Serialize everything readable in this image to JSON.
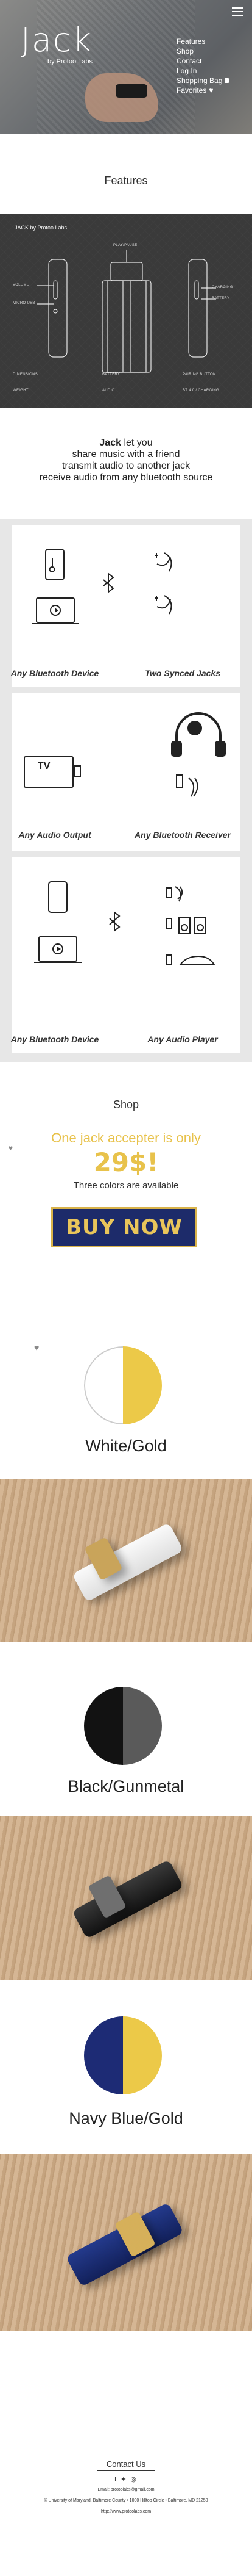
{
  "header": {
    "logo": "Jack",
    "logo_sub": "by Protoo Labs",
    "nav": [
      {
        "label": "Features"
      },
      {
        "label": "Shop"
      },
      {
        "label": "Contact"
      },
      {
        "label": "Log In"
      },
      {
        "label": "Shopping Bag"
      },
      {
        "label": "Favorites"
      }
    ]
  },
  "features": {
    "heading": "Features",
    "spec_title": "JACK by Protoo Labs",
    "labels": [
      {
        "text": "VOLUME"
      },
      {
        "text": "PAIRING BUTTON"
      },
      {
        "text": "PLAY/PAUSE"
      },
      {
        "text": "MICRO USB"
      },
      {
        "text": "BATTERY"
      },
      {
        "text": "WEIGHT"
      },
      {
        "text": "AUDIO"
      },
      {
        "text": "BT 4.0 / CHARGING"
      },
      {
        "text": "DIMENSIONS"
      }
    ],
    "labels_right": [
      {
        "text": "CHARGING"
      },
      {
        "text": "BATTERY"
      },
      {
        "text": "BT / 4.0"
      }
    ],
    "intro_lines": [
      {
        "text": "let you",
        "bold": "Jack"
      },
      {
        "text": "share music with a friend"
      },
      {
        "text": "transmit audio to another jack"
      },
      {
        "text": "receive audio from any bluetooth source"
      }
    ]
  },
  "usage": {
    "captions": [
      {
        "text": "Any Bluetooth Device"
      },
      {
        "text": "Two Synced Jacks"
      },
      {
        "text": "Any Audio Output"
      },
      {
        "text": "Any Bluetooth Receiver"
      },
      {
        "text": "Any Bluetooth Device"
      },
      {
        "text": "Any Audio Player"
      }
    ],
    "tv_label": "TV"
  },
  "shop": {
    "heading": "Shop",
    "offer_prefix": "One jack accepter is only",
    "price": "29$!",
    "colors_note": "Three colors are available",
    "buy_label": "BUY NOW",
    "colors": [
      {
        "name": "White/Gold",
        "left": "#ffffff",
        "right": "#ecc948"
      },
      {
        "name": "Black/Gunmetal",
        "left": "#121212",
        "right": "#5a5a5a"
      },
      {
        "name": "Navy Blue/Gold",
        "left": "#1d2b75",
        "right": "#ecc948"
      }
    ]
  },
  "footer": {
    "heading": "Contact Us",
    "email": "Email: protoolabs@gmail.com",
    "address": "© University of Maryland, Baltimore County • 1000 Hilltop Circle • Baltimore, MD 21250",
    "site": "http://www.protoolabs.com"
  },
  "accent_gold": "#e8c24b",
  "accent_navy": "#1d2b6a"
}
